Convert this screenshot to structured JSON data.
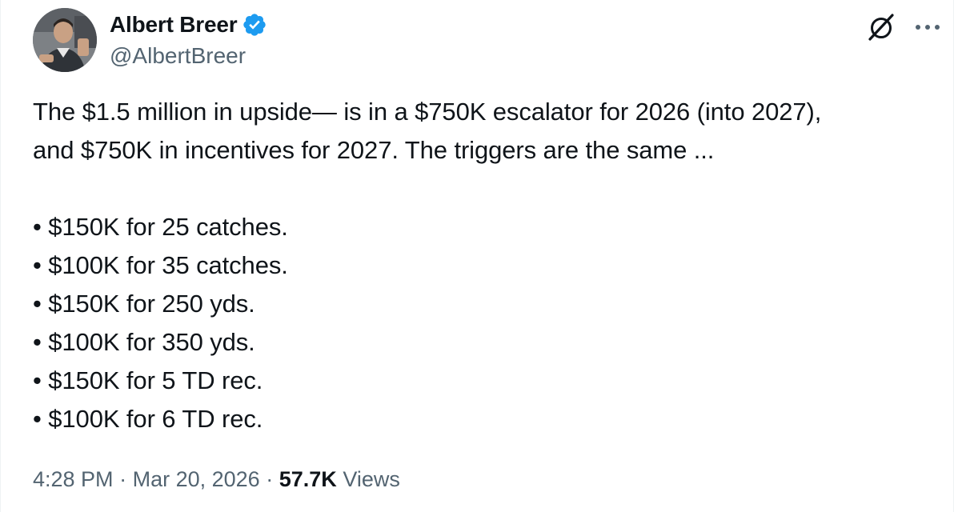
{
  "author": {
    "display_name": "Albert Breer",
    "handle": "@AlbertBreer",
    "verified": true,
    "avatar_icon": "profile-photo"
  },
  "actions": {
    "grok_icon": "grok-icon",
    "more_icon": "more-icon"
  },
  "tweet": {
    "text_lines": [
      "The $1.5 million in upside— is in a $750K escalator for 2026 (into 2027),",
      "and $750K in incentives for 2027. The triggers are the same ..."
    ],
    "bullets": [
      "• $150K for 25 catches.",
      "• $100K for 35 catches.",
      "• $150K for 250 yds.",
      "• $100K for 350 yds.",
      "• $150K for 5 TD rec.",
      "• $100K for 6 TD rec."
    ]
  },
  "meta": {
    "time": "4:28 PM",
    "date": "Mar 20, 2026",
    "separator": "·",
    "views_count": "57.7K",
    "views_label": "Views"
  },
  "colors": {
    "text": "#0f1419",
    "secondary": "#536471",
    "verified_blue": "#1d9bf0"
  }
}
